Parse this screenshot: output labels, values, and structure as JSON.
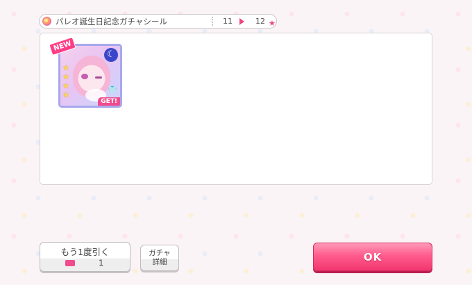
{
  "header": {
    "title": "パレオ誕生日記念ガチャシール",
    "page_from": "11",
    "page_to": "12",
    "icons": [
      "badge-icon",
      "next-arrow-icon",
      "star-icon"
    ]
  },
  "results": {
    "cards": [
      {
        "new_label": "NEW",
        "get_label": "GET!",
        "rarity_stars": 4,
        "attribute_icon": "moon-icon",
        "colors": {
          "frame": "#a7a7ee",
          "new": "#ff3d86",
          "get": "#f04b8c"
        }
      }
    ]
  },
  "buttons": {
    "again_label": "もう1度引く",
    "again_ticket_count": "1",
    "detail_line1": "ガチャ",
    "detail_line2": "詳細",
    "ok_label": "OK"
  },
  "colors": {
    "accent": "#f0457a",
    "ok_button": "#ff5c8d"
  }
}
